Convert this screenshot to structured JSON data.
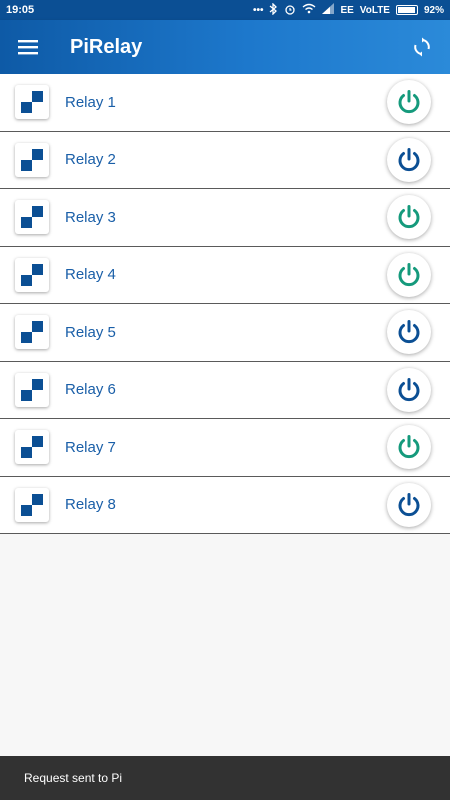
{
  "status_bar": {
    "time": "19:05",
    "dots": "•••",
    "carrier": "EE",
    "network": "VoLTE",
    "battery": "92%",
    "battery_level": 0.92
  },
  "app_bar": {
    "title": "PiRelay",
    "menu_icon": "hamburger-icon",
    "refresh_icon": "refresh-icon"
  },
  "relays": [
    {
      "label": "Relay 1",
      "state": "on",
      "color": "#159a7c"
    },
    {
      "label": "Relay 2",
      "state": "off",
      "color": "#0b4f94"
    },
    {
      "label": "Relay 3",
      "state": "on",
      "color": "#159a7c"
    },
    {
      "label": "Relay 4",
      "state": "on",
      "color": "#159a7c"
    },
    {
      "label": "Relay 5",
      "state": "off",
      "color": "#0b4f94"
    },
    {
      "label": "Relay 6",
      "state": "off",
      "color": "#0b4f94"
    },
    {
      "label": "Relay 7",
      "state": "on",
      "color": "#159a7c"
    },
    {
      "label": "Relay 8",
      "state": "off",
      "color": "#0b4f94"
    }
  ],
  "snackbar": {
    "message": "Request sent to Pi"
  },
  "colors": {
    "primary": "#0b4f94",
    "on": "#159a7c",
    "off": "#0b4f94"
  }
}
